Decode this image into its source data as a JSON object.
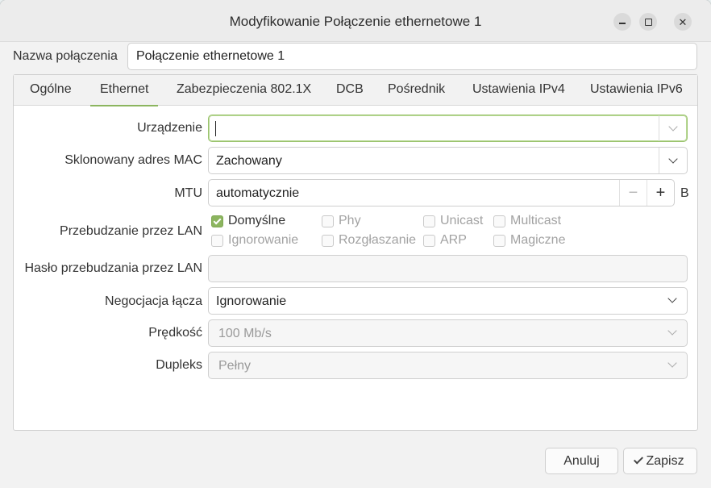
{
  "window": {
    "title": "Modyfikowanie Połączenie ethernetowe 1"
  },
  "connection": {
    "name_label": "Nazwa połączenia",
    "name_value": "Połączenie ethernetowe 1"
  },
  "tabs": [
    {
      "label": "Ogólne"
    },
    {
      "label": "Ethernet"
    },
    {
      "label": "Zabezpieczenia 802.1X"
    },
    {
      "label": "DCB"
    },
    {
      "label": "Pośrednik"
    },
    {
      "label": "Ustawienia IPv4"
    },
    {
      "label": "Ustawienia IPv6"
    }
  ],
  "active_tab": "Ethernet",
  "ethernet": {
    "device": {
      "label": "Urządzenie",
      "value": ""
    },
    "cloned_mac": {
      "label": "Sklonowany adres MAC",
      "value": "Zachowany"
    },
    "mtu": {
      "label": "MTU",
      "value": "automatycznie",
      "unit": "B",
      "minus": "−",
      "plus": "+"
    },
    "wol": {
      "label": "Przebudzanie przez LAN",
      "options": [
        {
          "label": "Domyślne",
          "checked": true
        },
        {
          "label": "Phy",
          "checked": false
        },
        {
          "label": "Unicast",
          "checked": false
        },
        {
          "label": "Multicast",
          "checked": false
        },
        {
          "label": "Ignorowanie",
          "checked": false
        },
        {
          "label": "Rozgłaszanie",
          "checked": false
        },
        {
          "label": "ARP",
          "checked": false
        },
        {
          "label": "Magiczne",
          "checked": false
        }
      ]
    },
    "wol_password": {
      "label": "Hasło przebudzania przez LAN",
      "value": ""
    },
    "link_negotiation": {
      "label": "Negocjacja łącza",
      "value": "Ignorowanie"
    },
    "speed": {
      "label": "Prędkość",
      "value": "100 Mb/s"
    },
    "duplex": {
      "label": "Dupleks",
      "value": "Pełny"
    }
  },
  "buttons": {
    "cancel": "Anuluj",
    "save": "Zapisz"
  },
  "colors": {
    "accent": "#8cb55f",
    "window_bg": "#f2f2f2"
  }
}
